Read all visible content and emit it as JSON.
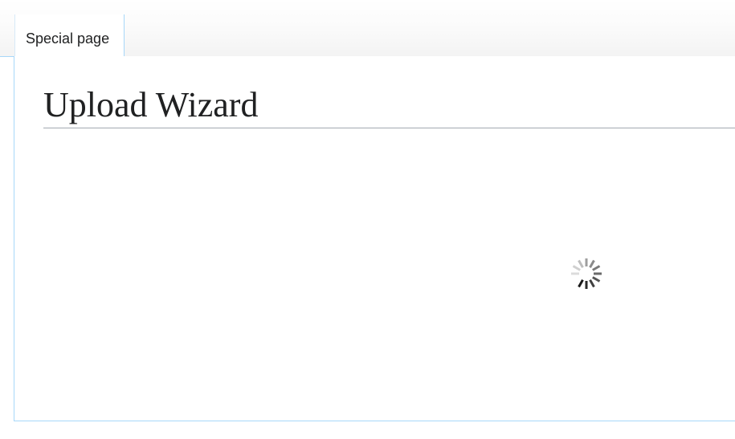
{
  "tabs": {
    "special_page": "Special page"
  },
  "page": {
    "title": "Upload Wizard"
  },
  "loading": {
    "icon": "loading-spinner-icon"
  },
  "colors": {
    "tab_border": "#a7d7f9",
    "heading_text": "#202122",
    "heading_rule": "#a2a9b1"
  }
}
